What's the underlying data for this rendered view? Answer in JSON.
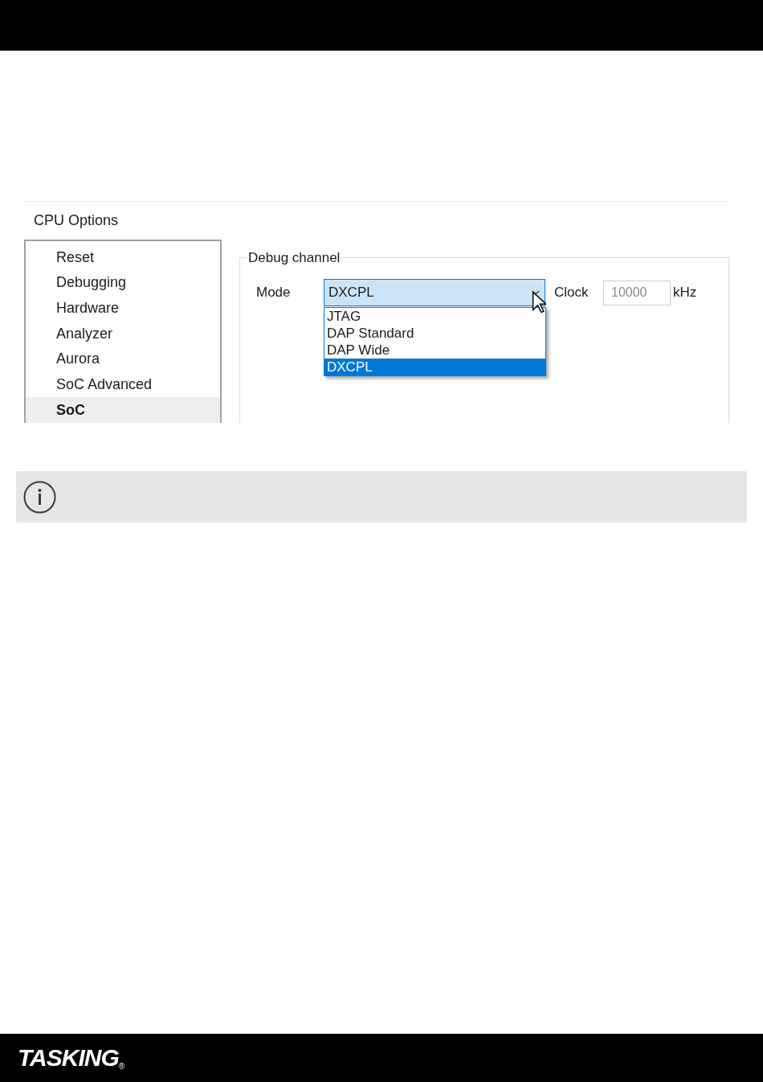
{
  "dialog": {
    "title": "CPU Options",
    "categories": [
      {
        "label": "Reset",
        "selected": false
      },
      {
        "label": "Debugging",
        "selected": false
      },
      {
        "label": "Hardware",
        "selected": false
      },
      {
        "label": "Analyzer",
        "selected": false
      },
      {
        "label": "Aurora",
        "selected": false
      },
      {
        "label": "SoC Advanced",
        "selected": false
      },
      {
        "label": "SoC",
        "selected": true
      }
    ],
    "group": {
      "title": "Debug channel",
      "mode": {
        "label": "Mode",
        "value": "DXCPL",
        "expanded": true,
        "options": [
          {
            "label": "JTAG",
            "selected": false
          },
          {
            "label": "DAP Standard",
            "selected": false
          },
          {
            "label": "DAP Wide",
            "selected": false
          },
          {
            "label": "DXCPL",
            "selected": true
          }
        ]
      },
      "clock": {
        "label": "Clock",
        "value": "10000",
        "unit": "kHz",
        "disabled": true
      }
    }
  },
  "footer": {
    "logo": "TASKING",
    "mark": "®"
  }
}
